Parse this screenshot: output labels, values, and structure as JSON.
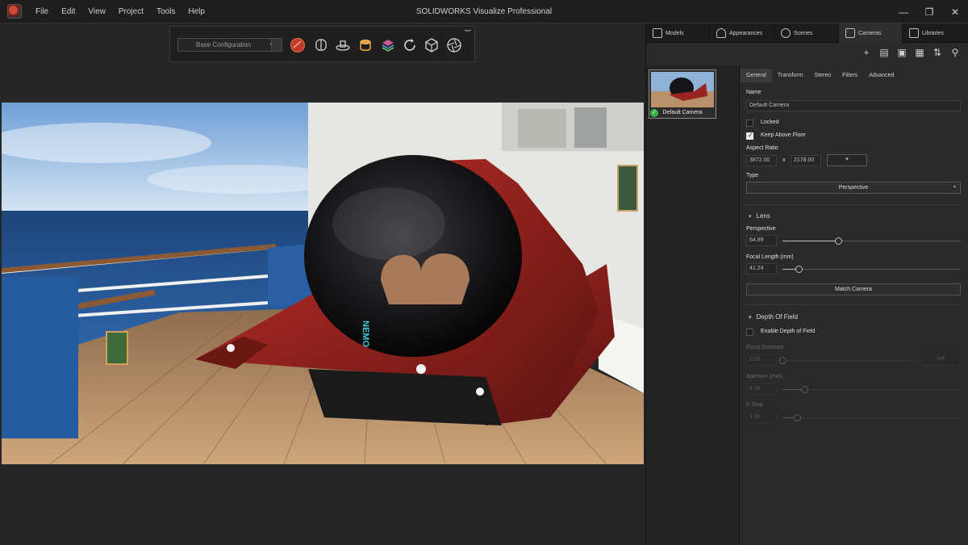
{
  "app": {
    "title": "SOLIDWORKS Visualize Professional",
    "menu": [
      "File",
      "Edit",
      "View",
      "Project",
      "Tools",
      "Help"
    ],
    "window_controls": {
      "minimize": "—",
      "restore": "❐",
      "close": "✕"
    }
  },
  "toolbar": {
    "configuration": "Base Configuration",
    "icons": [
      "render-mode-icon",
      "brain-icon",
      "turntable-icon",
      "object-stack-icon",
      "layers-icon",
      "refresh-icon",
      "cube-icon",
      "aperture-icon"
    ],
    "pin_glyph": "⌤"
  },
  "render": {
    "subject": "NEMO submarine on cruise ship deck",
    "hull_text": "NEMO",
    "hull_color": "#8a1e1c",
    "sky_color": "#8fb8e0",
    "sea_color": "#1f4d86",
    "deck_color": "#b8916a"
  },
  "panel": {
    "tabs": [
      {
        "label": "Models",
        "icon": "models-icon"
      },
      {
        "label": "Appearances",
        "icon": "appearances-icon"
      },
      {
        "label": "Scenes",
        "icon": "scenes-icon"
      },
      {
        "label": "Cameras",
        "icon": "cameras-icon"
      },
      {
        "label": "Libraries",
        "icon": "libraries-icon"
      }
    ],
    "active_tab": "Cameras",
    "actions": [
      "add-icon",
      "import-icon",
      "layout-icon",
      "grid-icon",
      "sort-icon",
      "search-icon"
    ],
    "camera_thumb": {
      "label": "Default Camera",
      "active": true
    },
    "subtabs": [
      "General",
      "Transform",
      "Stereo",
      "Filters",
      "Advanced"
    ],
    "active_subtab": "General",
    "general": {
      "name_label": "Name",
      "name_value": "Default Camera",
      "locked_label": "Locked",
      "locked": false,
      "keep_above_floor_label": "Keep Above Floor",
      "keep_above_floor": true,
      "aspect_ratio_label": "Aspect Ratio",
      "aspect_w": "3872.00",
      "aspect_x": "x",
      "aspect_h": "2178.00",
      "aspect_preset_caret": "▾",
      "type_label": "Type",
      "type_value": "Perspective"
    },
    "lens": {
      "section": "Lens",
      "perspective_label": "Perspective",
      "perspective_value": "64.89",
      "perspective_fraction": 0.31,
      "focal_label": "Focal Length (mm)",
      "focal_value": "41.24",
      "focal_fraction": 0.09,
      "match_camera": "Match Camera"
    },
    "dof": {
      "section": "Depth Of Field",
      "enable_label": "Enable Depth of Field",
      "enabled": false,
      "focal_distance_label": "Focal Distance",
      "focal_distance_value": "0.00",
      "focal_distance_button": "Set",
      "aperture_label": "Aperture (mm)",
      "aperture_value": "4.38",
      "aperture_fraction": 0.12,
      "fstop_label": "F Stop",
      "fstop_value": "1.50",
      "fstop_fraction": 0.08
    }
  }
}
